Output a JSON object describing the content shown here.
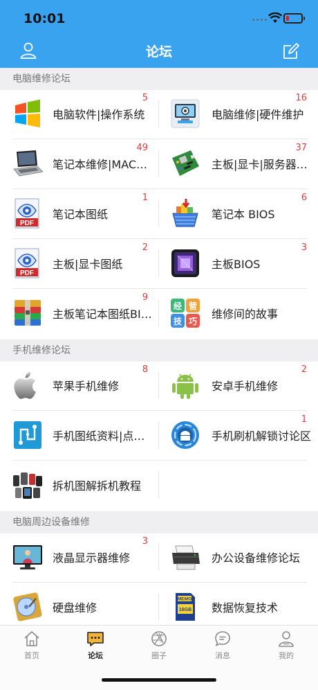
{
  "status": {
    "time": "10:01"
  },
  "nav": {
    "title": "论坛"
  },
  "sections": [
    {
      "title": "电脑维修论坛",
      "items": [
        {
          "label": "电脑软件|操作系统",
          "badge": "5",
          "icon": "windows-logo-icon"
        },
        {
          "label": "电脑维修|硬件维护",
          "badge": "16",
          "icon": "monitor-repair-icon"
        },
        {
          "label": "笔记本维修|MAC维修",
          "badge": "49",
          "icon": "laptop-icon"
        },
        {
          "label": "主板|显卡|服务器维修",
          "badge": "37",
          "icon": "motherboard-icon"
        },
        {
          "label": "笔记本图纸",
          "badge": "1",
          "icon": "pdf-document-icon"
        },
        {
          "label": "笔记本 BIOS",
          "badge": "6",
          "icon": "basket-download-icon"
        },
        {
          "label": "主板|显卡图纸",
          "badge": "2",
          "icon": "pdf-document-icon"
        },
        {
          "label": "主板BIOS",
          "badge": "3",
          "icon": "chip-icon"
        },
        {
          "label": "主板笔记本图纸BIOS",
          "badge": "9",
          "icon": "archive-books-icon"
        },
        {
          "label": "维修间的故事",
          "badge": "",
          "icon": "business-tiles-icon",
          "tiles": [
            "经",
            "营",
            "技",
            "巧"
          ]
        }
      ]
    },
    {
      "title": "手机维修论坛",
      "items": [
        {
          "label": "苹果手机维修",
          "badge": "8",
          "icon": "apple-logo-icon"
        },
        {
          "label": "安卓手机维修",
          "badge": "2",
          "icon": "android-robot-icon"
        },
        {
          "label": "手机图纸资料|点位图",
          "badge": "",
          "icon": "circuit-diagram-icon"
        },
        {
          "label": "手机刷机解锁讨论区",
          "badge": "1",
          "icon": "android-circle-icon"
        },
        {
          "label": "拆机图解拆机教程",
          "badge": "",
          "icon": "phones-teardown-icon"
        }
      ]
    },
    {
      "title": "电脑周边设备维修",
      "items": [
        {
          "label": "液晶显示器维修",
          "badge": "3",
          "icon": "lcd-monitor-icon"
        },
        {
          "label": "办公设备维修论坛",
          "badge": "",
          "icon": "printer-icon"
        },
        {
          "label": "硬盘维修",
          "badge": "",
          "icon": "hard-disk-icon"
        },
        {
          "label": "数据恢复技术",
          "badge": "",
          "icon": "memory-card-icon",
          "card_text": [
            "MEMO",
            "16GB"
          ]
        }
      ]
    }
  ],
  "tabs": [
    {
      "label": "首页",
      "icon": "home-icon"
    },
    {
      "label": "论坛",
      "icon": "chat-bubble-icon",
      "active": true
    },
    {
      "label": "圈子",
      "icon": "aperture-icon"
    },
    {
      "label": "消息",
      "icon": "message-icon"
    },
    {
      "label": "我的",
      "icon": "person-icon"
    }
  ],
  "colors": {
    "header": "#3aa3f0",
    "badge": "#e23b3b",
    "section_bg": "#efeff1",
    "tab_active": "#f3b43a"
  }
}
